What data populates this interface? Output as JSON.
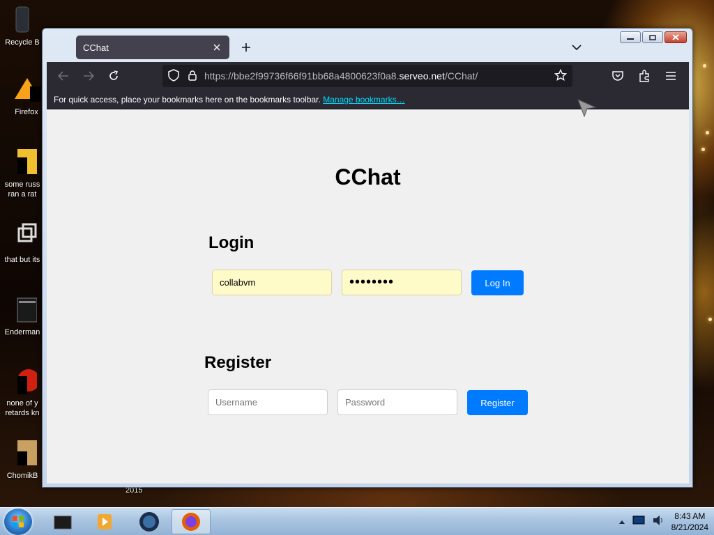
{
  "desktop": {
    "icons": [
      {
        "label": "Recycle B"
      },
      {
        "label": "Firefox"
      },
      {
        "label": "some russ\nran a rat"
      },
      {
        "label": "that but its"
      },
      {
        "label": "Enderman"
      },
      {
        "label": "none of y\nretards kn"
      },
      {
        "label": "ChomikB"
      }
    ],
    "stray_text": "2015"
  },
  "browser": {
    "tab": {
      "title": "CChat"
    },
    "url": {
      "prefix": "https://bbe2f99736f66f91bb68a4800623f0a8.",
      "host": "serveo.net",
      "path": "/CChat/"
    },
    "bookmarks_bar": {
      "text": "For quick access, place your bookmarks here on the bookmarks toolbar.",
      "link": "Manage bookmarks…"
    }
  },
  "page": {
    "title": "CChat",
    "login": {
      "heading": "Login",
      "username_value": "collabvm",
      "password_value": "••••••••",
      "button": "Log In"
    },
    "register": {
      "heading": "Register",
      "username_placeholder": "Username",
      "password_placeholder": "Password",
      "button": "Register"
    }
  },
  "taskbar": {
    "clock": {
      "time": "8:43 AM",
      "date": "8/21/2024"
    }
  },
  "colors": {
    "accent": "#007bff",
    "autofill": "#fffbc9",
    "browser_chrome": "#2b2a33"
  }
}
